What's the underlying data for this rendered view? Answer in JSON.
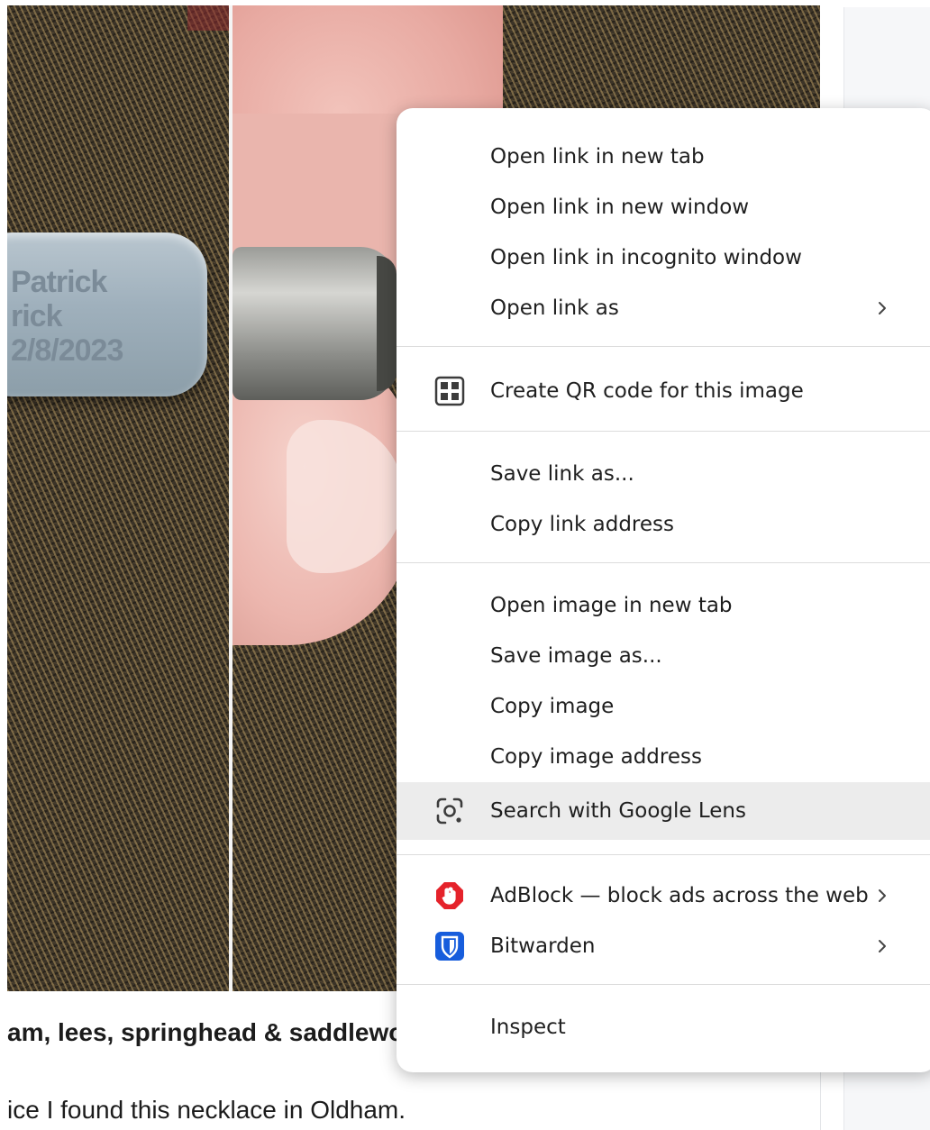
{
  "photo": {
    "tag_lines": [
      "Patrick",
      "rick",
      "2/8/2023"
    ]
  },
  "post": {
    "title": "am, lees, springhead & saddlewo",
    "body": "ice I found this necklace in Oldham."
  },
  "context_menu": {
    "groups": [
      [
        {
          "label": "Open link in new tab"
        },
        {
          "label": "Open link in new window"
        },
        {
          "label": "Open link in incognito window"
        },
        {
          "label": "Open link as",
          "submenu": true
        }
      ],
      [
        {
          "label": "Create QR code for this image",
          "icon": "qr-code-icon"
        }
      ],
      [
        {
          "label": "Save link as..."
        },
        {
          "label": "Copy link address"
        }
      ],
      [
        {
          "label": "Open image in new tab"
        },
        {
          "label": "Save image as..."
        },
        {
          "label": "Copy image"
        },
        {
          "label": "Copy image address"
        },
        {
          "label": "Search with Google Lens",
          "icon": "google-lens-icon",
          "hovered": true
        }
      ],
      [
        {
          "label": "AdBlock — block ads across the web",
          "icon": "adblock-icon",
          "submenu": true
        },
        {
          "label": "Bitwarden",
          "icon": "bitwarden-icon",
          "submenu": true
        }
      ],
      [
        {
          "label": "Inspect"
        }
      ]
    ]
  },
  "colors": {
    "adblock_red": "#e5232b",
    "bitwarden_blue": "#175ddc",
    "hover_bg": "#ececec"
  }
}
